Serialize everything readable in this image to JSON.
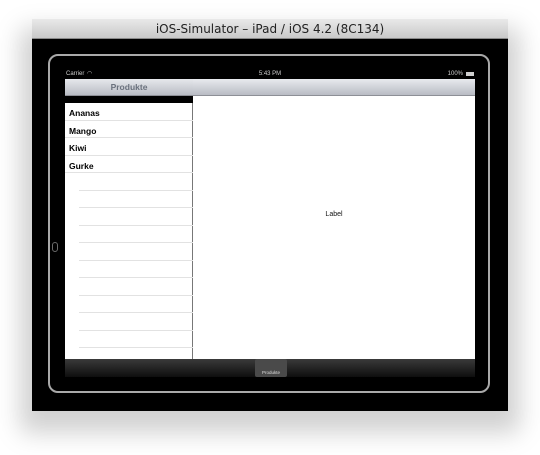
{
  "window": {
    "title": "iOS-Simulator – iPad / iOS 4.2 (8C134)"
  },
  "status_bar": {
    "carrier": "Carrier",
    "time": "5:43 PM",
    "battery": "100%"
  },
  "master": {
    "nav_title": "Produkte",
    "items": [
      {
        "label": "Ananas"
      },
      {
        "label": "Mango"
      },
      {
        "label": "Kiwi"
      },
      {
        "label": "Gurke"
      }
    ]
  },
  "detail": {
    "label": "Label"
  },
  "tab_bar": {
    "items": [
      {
        "label": "Produkte"
      }
    ]
  },
  "icons": {
    "wifi": "wifi-icon",
    "battery": "battery-icon",
    "home": "home-button-icon"
  }
}
